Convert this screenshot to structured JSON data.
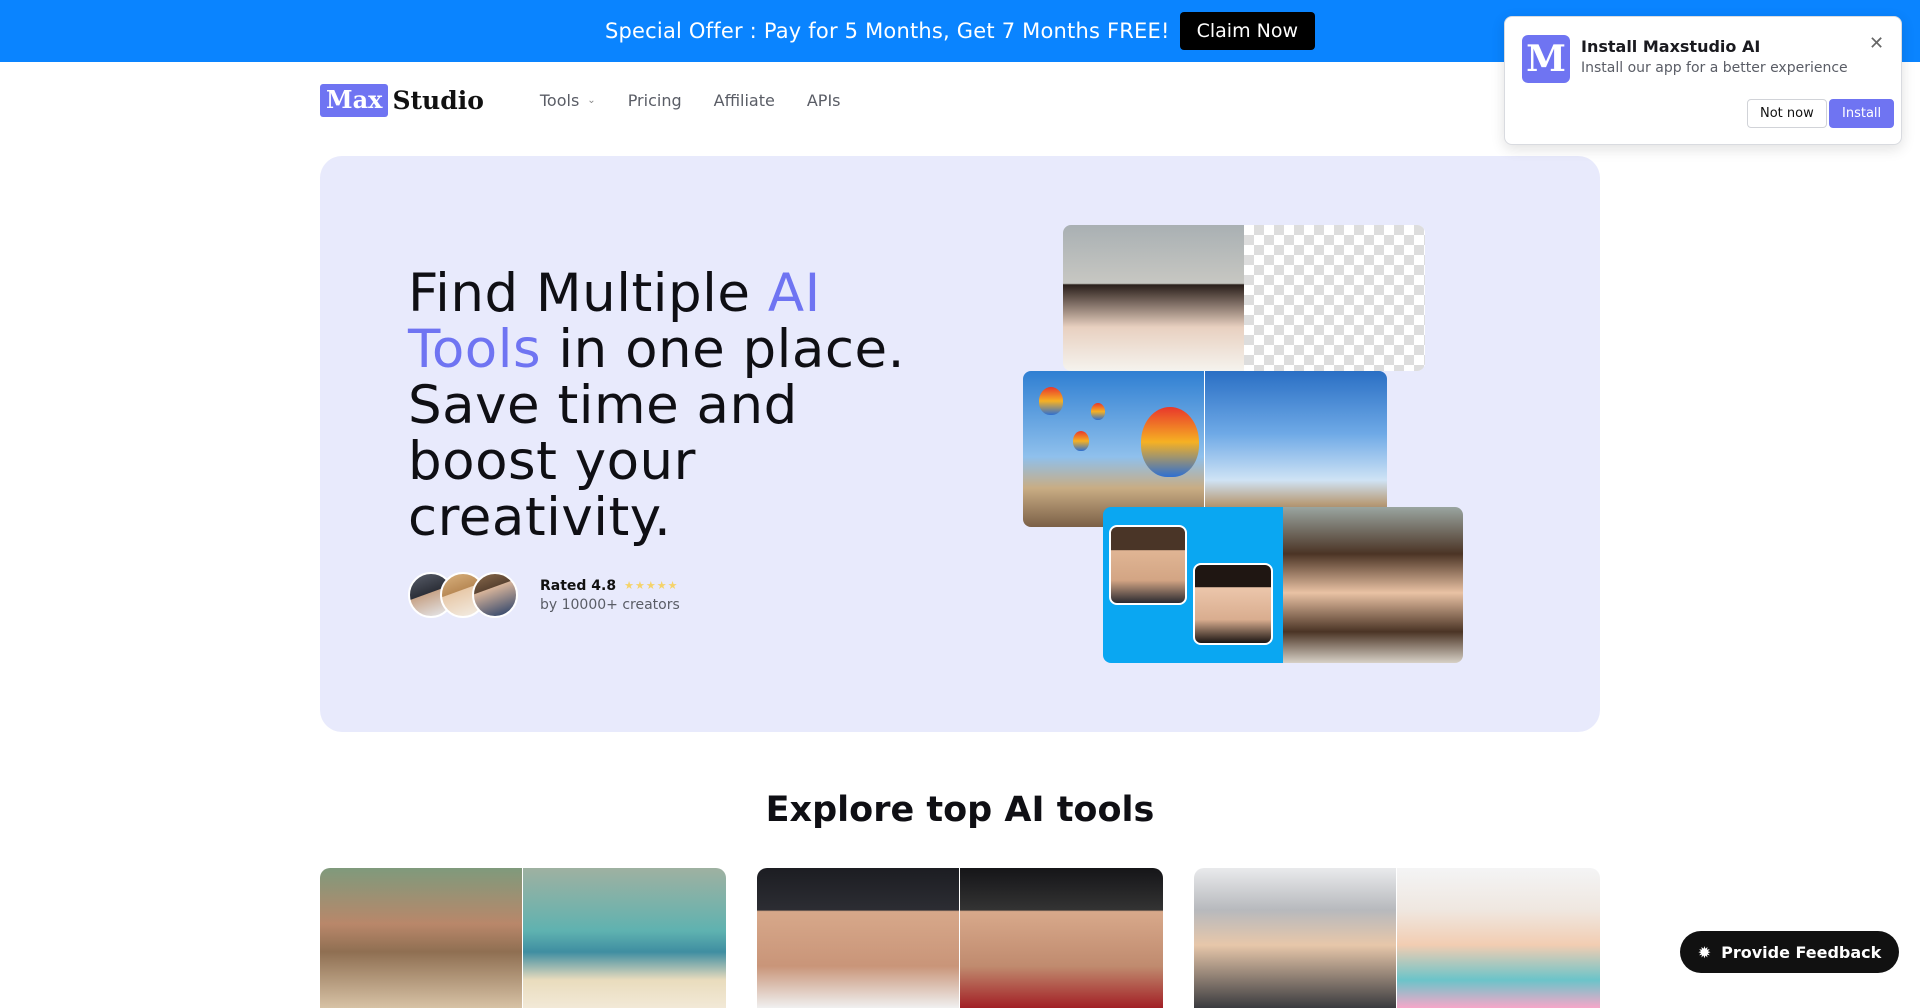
{
  "banner": {
    "text": "Special Offer : Pay for 5 Months, Get 7 Months FREE!",
    "cta": "Claim Now"
  },
  "brand": {
    "logo_box": "Max",
    "logo_text": "Studio",
    "accent_color": "#6f74f2",
    "banner_color": "#0a84ff"
  },
  "nav": {
    "items": [
      {
        "label": "Tools",
        "has_dropdown": true
      },
      {
        "label": "Pricing"
      },
      {
        "label": "Affiliate"
      },
      {
        "label": "APIs"
      }
    ]
  },
  "hero": {
    "title_part1": "Find Multiple ",
    "title_highlight": "AI Tools",
    "title_part2": " in one place. Save time and boost your creativity.",
    "rating_label": "Rated 4.8",
    "stars": "★★★★★",
    "rating_sub": "by 10000+ creators"
  },
  "section": {
    "title": "Explore top AI tools"
  },
  "popup": {
    "logo": "M",
    "title": "Install Maxstudio AI",
    "subtitle": "Install our app for a better experience",
    "close": "✕",
    "not_now": "Not now",
    "install": "Install"
  },
  "feedback": {
    "icon": "lightbulb-icon",
    "label": "Provide Feedback"
  }
}
